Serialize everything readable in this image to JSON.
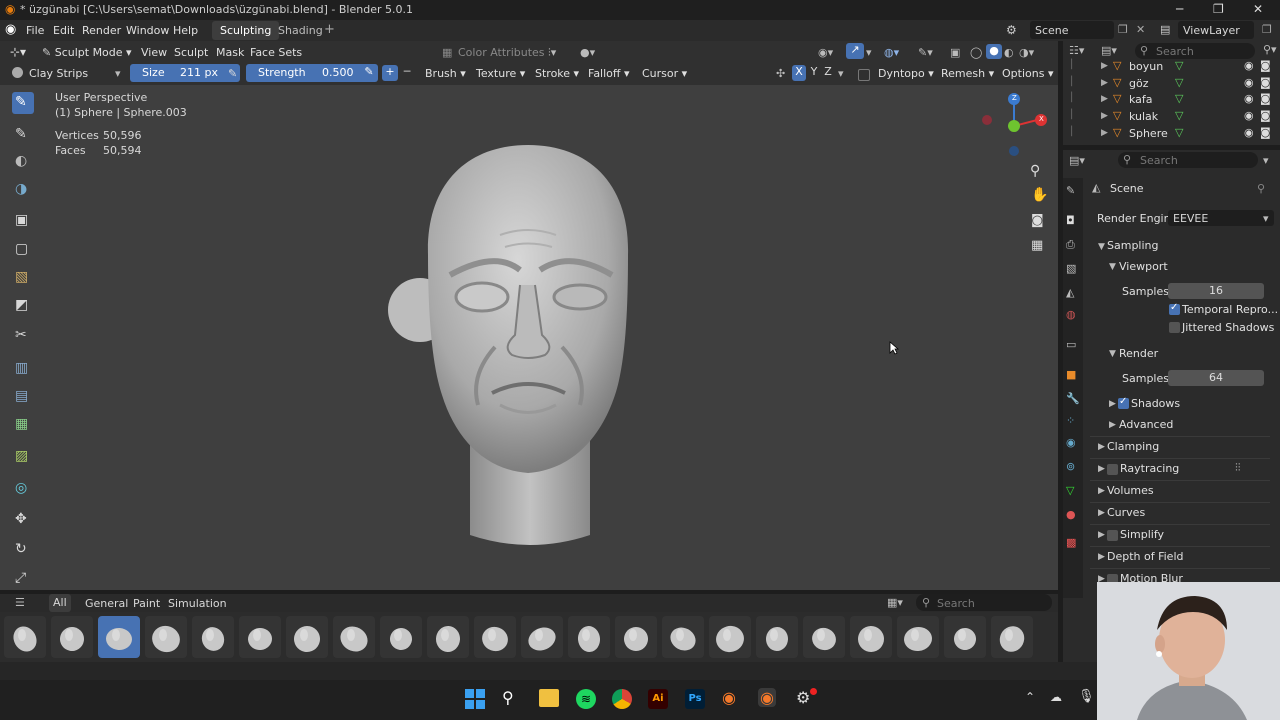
{
  "window": {
    "title": "* üzgünabi [C:\\Users\\semat\\Downloads\\üzgünabi.blend] - Blender 5.0.1",
    "minimize": "─",
    "maximize": "❐",
    "close": "✕"
  },
  "menu": {
    "items": [
      "File",
      "Edit",
      "Render",
      "Window",
      "Help"
    ],
    "workspaces": [
      "Sculpting",
      "Shading"
    ],
    "add_workspace": "+",
    "scene_label": "Scene",
    "view_layer_label": "ViewLayer"
  },
  "viewport_header": {
    "mode": "Sculpt Mode",
    "menus": [
      "View",
      "Sculpt",
      "Mask",
      "Face Sets"
    ],
    "color_attributes": "Color Attributes"
  },
  "tool_header": {
    "brush_name": "Clay Strips",
    "size_label": "Size",
    "size_value": "211 px",
    "strength_label": "Strength",
    "strength_value": "0.500",
    "plus": "+",
    "minus": "─",
    "menus": [
      "Brush",
      "Texture",
      "Stroke",
      "Falloff",
      "Cursor"
    ],
    "axes": [
      "X",
      "Y",
      "Z"
    ],
    "dyntopo": "Dyntopo",
    "remesh": "Remesh",
    "options": "Options"
  },
  "overlay": {
    "perspective": "User Perspective",
    "object": "(1) Sphere | Sphere.003",
    "vertices_label": "Vertices",
    "vertices_value": "50,596",
    "faces_label": "Faces",
    "faces_value": "50,594"
  },
  "gizmo": {
    "z": "Z",
    "x": "X"
  },
  "asset_shelf": {
    "tabs": [
      "All",
      "General",
      "Paint",
      "Simulation"
    ],
    "search_placeholder": "Search"
  },
  "outliner": {
    "search_placeholder": "Search",
    "items": [
      "boyun",
      "göz",
      "kafa",
      "kulak",
      "Sphere"
    ]
  },
  "properties": {
    "search_placeholder": "Search",
    "scene": "Scene",
    "render_engine_label": "Render Engine",
    "render_engine_value": "EEVEE",
    "sampling": "Sampling",
    "viewport": "Viewport",
    "samples_label": "Samples",
    "viewport_samples": "16",
    "temporal_reprojection": "Temporal Repro...",
    "jittered_shadows": "Jittered Shadows",
    "render": "Render",
    "render_samples": "64",
    "shadows": "Shadows",
    "advanced": "Advanced",
    "sections": [
      "Clamping",
      "Raytracing",
      "Volumes",
      "Curves",
      "Simplify",
      "Depth of Field",
      "Motion Blur"
    ]
  },
  "taskbar": {
    "adobe_illustrator": "Ai",
    "photoshop": "Ps"
  },
  "colors": {
    "accent": "#4772b3",
    "viewport_bg": "#3f3f3f",
    "panel_bg": "#2b2b2b"
  }
}
